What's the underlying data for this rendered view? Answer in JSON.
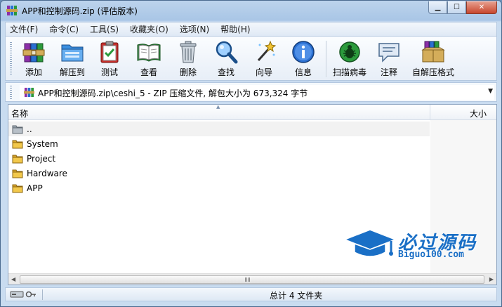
{
  "window": {
    "title": "APP和控制源码.zip (评估版本)"
  },
  "menu": [
    {
      "label": "文件(F)"
    },
    {
      "label": "命令(C)"
    },
    {
      "label": "工具(S)"
    },
    {
      "label": "收藏夹(O)"
    },
    {
      "label": "选项(N)"
    },
    {
      "label": "帮助(H)"
    }
  ],
  "toolbar": [
    {
      "label": "添加",
      "icon": "add-books-icon"
    },
    {
      "label": "解压到",
      "icon": "extract-folder-icon"
    },
    {
      "label": "测试",
      "icon": "test-clipboard-icon"
    },
    {
      "label": "查看",
      "icon": "view-book-icon"
    },
    {
      "label": "删除",
      "icon": "trash-icon"
    },
    {
      "label": "查找",
      "icon": "magnifier-icon"
    },
    {
      "label": "向导",
      "icon": "wizard-wand-icon"
    },
    {
      "label": "信息",
      "icon": "info-icon"
    },
    {
      "label": "扫描病毒",
      "icon": "virus-scan-icon"
    },
    {
      "label": "注释",
      "icon": "comment-icon"
    },
    {
      "label": "自解压格式",
      "icon": "sfx-box-icon"
    }
  ],
  "address": {
    "path": "APP和控制源码.zip\\ceshi_5 - ZIP 压缩文件, 解包大小为 673,324 字节"
  },
  "list": {
    "columns": [
      "名称",
      "大小"
    ],
    "rows": [
      {
        "name": ".."
      },
      {
        "name": "System"
      },
      {
        "name": "Project"
      },
      {
        "name": "Hardware"
      },
      {
        "name": "APP"
      }
    ]
  },
  "status": {
    "text": "总计 4 文件夹"
  },
  "watermark": {
    "title": "必过源码",
    "subtitle": "Biguo100.com"
  },
  "colors": {
    "accent": "#1a6fc6",
    "titlebar": "#a9c6e6",
    "folder": "#e9b93c"
  }
}
